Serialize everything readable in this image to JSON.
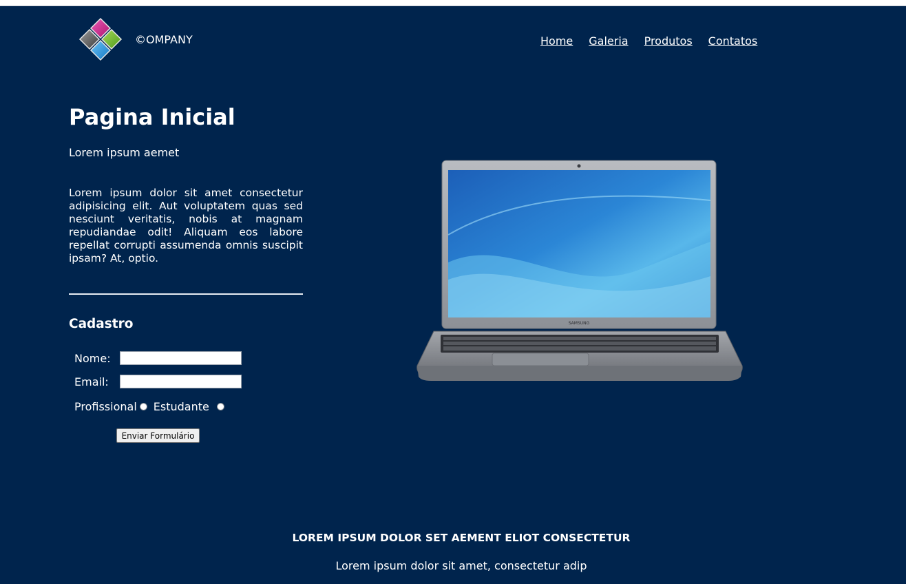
{
  "header": {
    "company_name": "©OMPANY",
    "nav": [
      {
        "label": "Home"
      },
      {
        "label": "Galeria"
      },
      {
        "label": "Produtos"
      },
      {
        "label": "Contatos"
      }
    ]
  },
  "main": {
    "title": "Pagina Inicial",
    "subtitle": "Lorem ipsum aemet",
    "paragraph": "Lorem ipsum dolor sit amet consectetur adipisicing elit. Aut voluptatem quas sed nesciunt veritatis, nobis at magnam repudiandae odit! Aliquam eos labore repellat corrupti assumenda omnis suscipit ipsam? At, optio."
  },
  "form": {
    "title": "Cadastro",
    "nome_label": "Nome:",
    "nome_value": "",
    "email_label": "Email:",
    "email_value": "",
    "option_profissional": "Profissional",
    "option_estudante": "Estudante",
    "submit_label": "Enviar Formulário"
  },
  "laptop": {
    "brand": "SAMSUNG"
  },
  "footer": {
    "title": "LOREM IPSUM DOLOR SET AEMENT ELIOT CONSECTETUR",
    "text": "Lorem ipsum dolor sit amet, consectetur adip"
  },
  "colors": {
    "background": "#00244d",
    "text": "#ffffff"
  }
}
